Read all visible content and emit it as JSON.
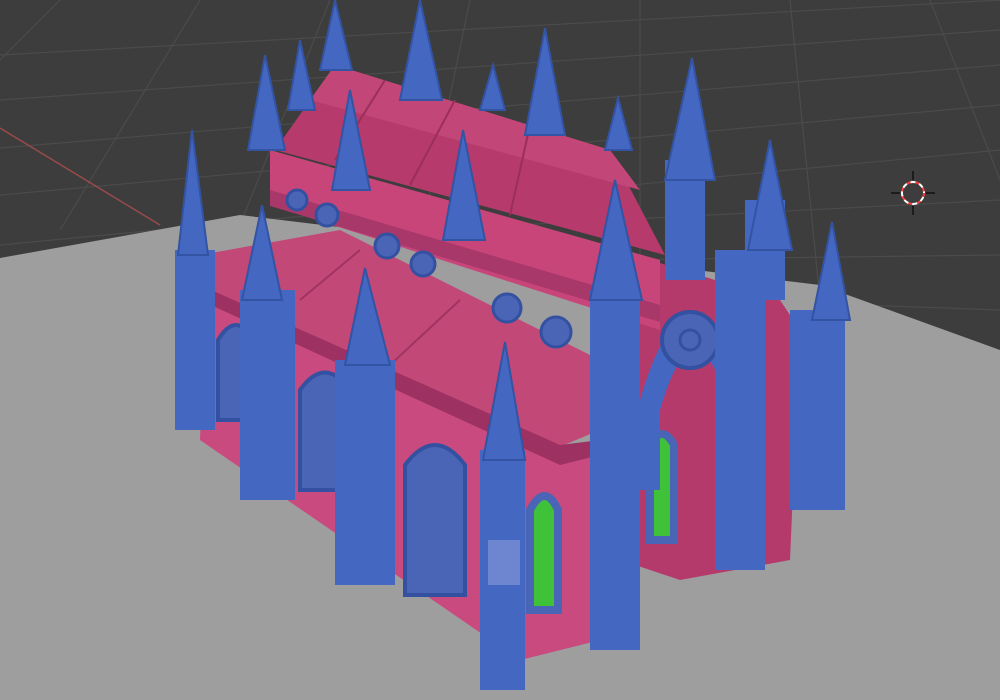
{
  "viewport": {
    "background_color": "#3d3d3d",
    "grid_color": "#4a4a4a",
    "ground_color": "#9d9d9d",
    "x_axis_color": "#9a4a4a",
    "cursor_colors": [
      "#ff3b3b",
      "#ffffff"
    ]
  },
  "model": {
    "wall_color": "#c8457a",
    "roof_color": "#b63a6c",
    "spire_color": "#4467c2",
    "spire_dark": "#3353a3",
    "door_color": "#3fc23a",
    "window_color": "#4a65b6"
  },
  "icons": {
    "cursor": "3d-cursor-icon"
  }
}
